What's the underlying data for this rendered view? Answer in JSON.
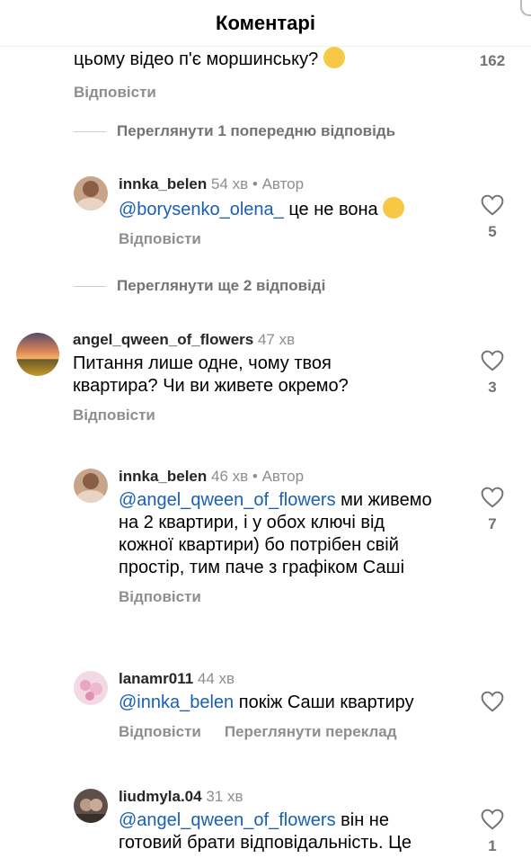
{
  "header": {
    "title": "Коментарі"
  },
  "top_partial": {
    "text": "цьому відео п'є моршинську?",
    "emoji": "😂",
    "reply": "Відповісти",
    "likes": "162"
  },
  "view_prev_1": "Переглянути 1 попередню відповідь",
  "comments": [
    {
      "user": "innka_belen",
      "time": "54 хв",
      "author": "Автор",
      "mention": "@borysenko_olena_",
      "text": " це не вона",
      "emoji": "😁",
      "reply": "Відповісти",
      "likes": "5"
    },
    {
      "user": "angel_qween_of_flowers",
      "time": "47 хв",
      "text": "Питання лише одне, чому твоя квартира? Чи ви живете окремо?",
      "reply": "Відповісти",
      "likes": "3"
    },
    {
      "user": "innka_belen",
      "time": "46 хв",
      "author": "Автор",
      "mention": "@angel_qween_of_flowers",
      "text": " ми живемо на 2 квартири, і у обох ключі від кожної квартири) бо потрібен свій простір, тим паче з графіком Саші",
      "reply": "Відповісти",
      "likes": "7"
    },
    {
      "user": "lanamr011",
      "time": "44 хв",
      "mention": "@innka_belen",
      "text": " покіж Саши квартиру",
      "reply": "Відповісти",
      "translate": "Переглянути переклад",
      "likes": ""
    },
    {
      "user": "liudmyla.04",
      "time": "31 хв",
      "mention": "@angel_qween_of_flowers",
      "text": " він не готовий брати відповідальність. Це",
      "likes": "1"
    }
  ],
  "view_more_2": "Переглянути ще 2 відповіді",
  "dot": "•",
  "colors": {
    "mention": "#1a5fb4",
    "muted": "#8e8e8e"
  },
  "icons": [
    "heart-outline-icon",
    "avatar-image"
  ]
}
